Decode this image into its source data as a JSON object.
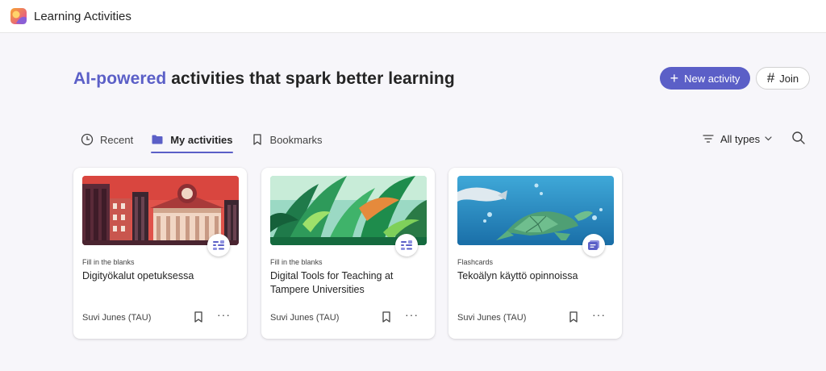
{
  "app": {
    "title": "Learning Activities",
    "logo_icon": "learning-activities-logo"
  },
  "hero": {
    "accent": "AI-powered",
    "rest": " activities that spark better learning"
  },
  "actions": {
    "new_label": "New activity",
    "join_label": "Join"
  },
  "tabs": [
    {
      "label": "Recent",
      "icon": "clock-icon",
      "active": false
    },
    {
      "label": "My activities",
      "icon": "folder-icon",
      "active": true
    },
    {
      "label": "Bookmarks",
      "icon": "bookmark-icon",
      "active": false
    }
  ],
  "filter": {
    "label": "All types",
    "icon": "filter-icon"
  },
  "cards": [
    {
      "type": "Fill in the blanks",
      "title": "Digityökalut opetuksessa",
      "author": "Suvi Junes (TAU)",
      "badge_icon": "fill-blanks-icon"
    },
    {
      "type": "Fill in the blanks",
      "title": "Digital Tools for Teaching at Tampere Universities",
      "author": "Suvi Junes (TAU)",
      "badge_icon": "fill-blanks-icon"
    },
    {
      "type": "Flashcards",
      "title": "Tekoälyn käyttö opinnoissa",
      "author": "Suvi Junes (TAU)",
      "badge_icon": "flashcards-icon"
    }
  ],
  "more_glyph": "···",
  "colors": {
    "accent": "#5b5fc7",
    "background": "#f7f6fa"
  }
}
